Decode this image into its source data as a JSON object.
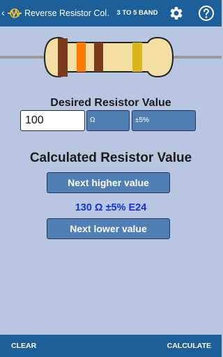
{
  "appbar": {
    "title": "Reverse Resistor Col…",
    "band_button": "3 TO 5 BAND",
    "icons": [
      "back-icon",
      "app-logo-icon",
      "gear-icon",
      "help-icon"
    ]
  },
  "resistor": {
    "body_color": "#f3dfa3",
    "band_colors": [
      "#7a3a1c",
      "#ff7a00",
      "#7a3a1c",
      "#d8b51c"
    ]
  },
  "desired": {
    "title": "Desired Resistor Value",
    "value": "100",
    "unit": "Ω",
    "tolerance": "±5%"
  },
  "calculated": {
    "title": "Calculated Resistor Value",
    "next_higher_label": "Next higher value",
    "result": "130 Ω ±5% E24",
    "next_lower_label": "Next lower value"
  },
  "bottombar": {
    "clear_label": "CLEAR",
    "calculate_label": "CALCULATE"
  },
  "colors": {
    "primary": "#1d5f99",
    "background": "#b8c6e2",
    "button": "#4f7fb3",
    "result_text": "#1532d8"
  }
}
